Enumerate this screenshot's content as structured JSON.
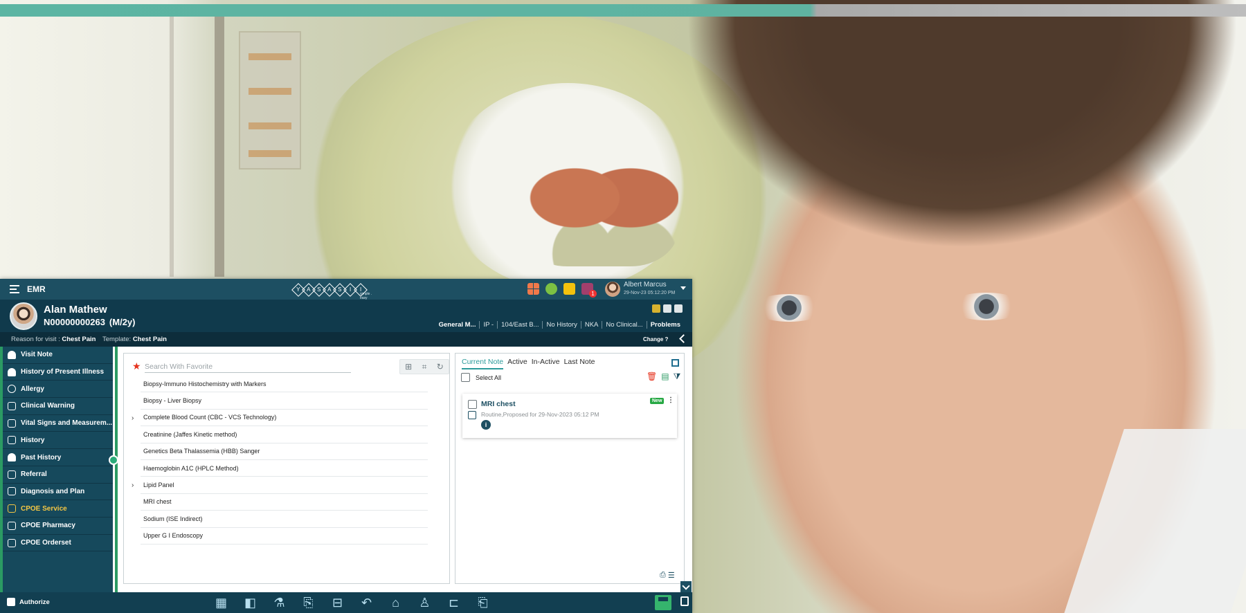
{
  "app": {
    "name": "EMR",
    "logo_text": [
      "Y",
      "A",
      "S",
      "A",
      "S",
      "I",
      "I"
    ],
    "logo_tagline": "simple . easy",
    "user": {
      "name": "Albert Marcus",
      "datetime": "29-Nov-23 05:12:20 PM"
    },
    "notification_count": "1"
  },
  "patient": {
    "name": "Alan Mathew",
    "id": "N00000000263",
    "age_gender": "(M/2y)",
    "meta": [
      "General M...",
      "IP -",
      "104/East B...",
      "No History",
      "NKA",
      "No Clinical...",
      "Problems"
    ]
  },
  "reason": {
    "reason_label": "Reason for visit :",
    "reason_value": "Chest Pain",
    "template_label": "Template:",
    "template_value": "Chest Pain",
    "change_label": "Change ?"
  },
  "sidebar": {
    "items": [
      {
        "label": "Visit Note"
      },
      {
        "label": "History of Present Illness"
      },
      {
        "label": "Allergy"
      },
      {
        "label": "Clinical Warning"
      },
      {
        "label": "Vital Signs and Measurem..."
      },
      {
        "label": "History"
      },
      {
        "label": "Past History"
      },
      {
        "label": "Referral"
      },
      {
        "label": "Diagnosis and Plan"
      },
      {
        "label": "CPOE Service",
        "active": true
      },
      {
        "label": "CPOE Pharmacy"
      },
      {
        "label": "CPOE Orderset"
      }
    ]
  },
  "services": {
    "search_placeholder": "Search With Favorite",
    "items": [
      {
        "label": "Biopsy-Immuno Histochemistry with Markers",
        "expandable": false
      },
      {
        "label": "Biopsy - Liver Biopsy",
        "expandable": false
      },
      {
        "label": "Complete Blood Count (CBC - VCS Technology)",
        "expandable": true
      },
      {
        "label": "Creatinine (Jaffes Kinetic method)",
        "expandable": false
      },
      {
        "label": "Genetics Beta Thalassemia (HBB) Sanger",
        "expandable": false
      },
      {
        "label": "Haemoglobin A1C (HPLC Method)",
        "expandable": false
      },
      {
        "label": "Lipid Panel",
        "expandable": true
      },
      {
        "label": "MRI chest",
        "expandable": false
      },
      {
        "label": "Sodium (ISE Indirect)",
        "expandable": false
      },
      {
        "label": "Upper G I Endoscopy",
        "expandable": false
      }
    ]
  },
  "notes": {
    "tabs": [
      "Current Note",
      "Active",
      "In-Active",
      "Last Note"
    ],
    "select_all": "Select All",
    "card": {
      "title": "MRI chest",
      "subtitle": "Routine,Proposed for 29-Nov-2023 05:12 PM",
      "badge": "New",
      "info": "i"
    }
  },
  "bottom": {
    "authorize_label": "Authorize"
  },
  "colors": {
    "primary": "#1d4f62",
    "accent": "#2b9a63",
    "active": "#f6c744",
    "badge_new": "#27a844"
  }
}
